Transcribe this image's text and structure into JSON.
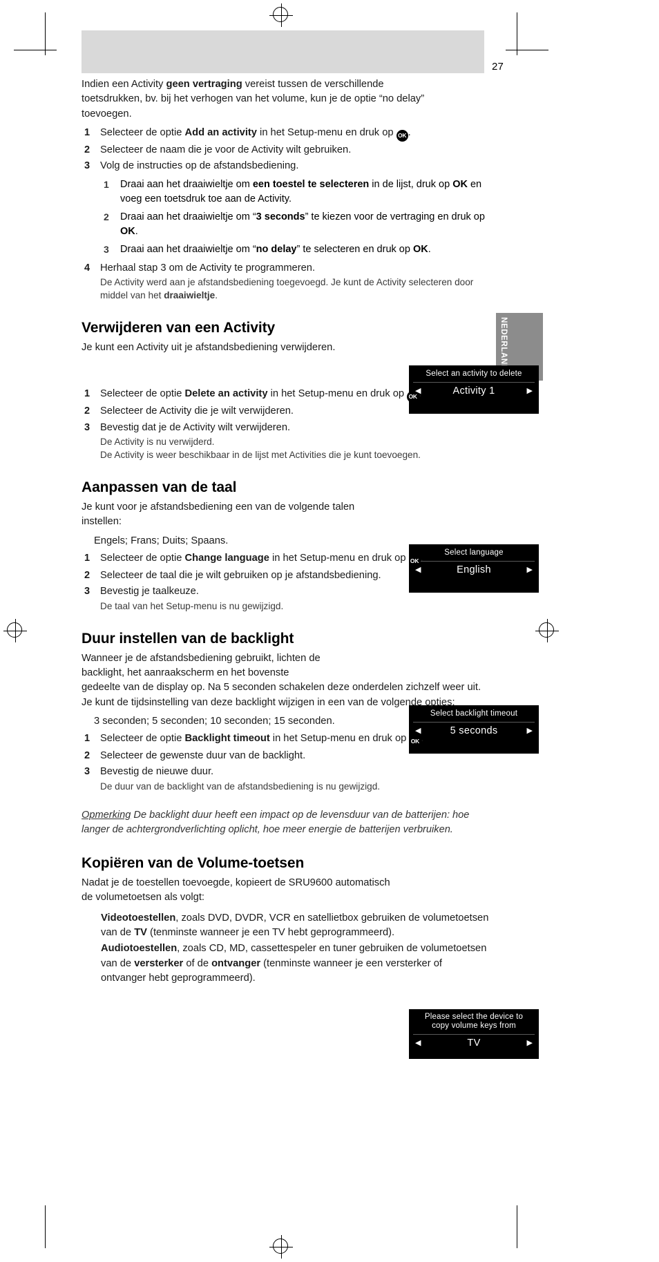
{
  "page": {
    "number": "27",
    "side_tab_label": "NEDERLANDS"
  },
  "intro": {
    "text_before": "Indien een Activity ",
    "bold1": "geen vertraging",
    "text_after": " vereist tussen de verschillende toetsdrukken, bv. bij het verhogen van het volume, kun je de optie “no delay” toevoegen."
  },
  "section_add": {
    "steps": [
      {
        "num": "1",
        "pre": "Selecteer de optie ",
        "bold": "Add an activity",
        "post": " in het Setup-menu en druk op ",
        "tail": "."
      },
      {
        "num": "2",
        "pre": "Selecteer de naam die je voor de Activity wilt gebruiken.",
        "bold": "",
        "post": "",
        "tail": ""
      },
      {
        "num": "3",
        "pre": "Volg de instructies op de afstandsbediening.",
        "bold": "",
        "post": "",
        "tail": ""
      }
    ],
    "substeps": [
      {
        "num": "1",
        "pre": "Draai aan het draaiwieltje om ",
        "bold": "een toestel te selecteren",
        "mid": " in de lijst, druk op ",
        "bold2": "OK",
        "post": " en voeg een toetsdruk toe aan de Activity."
      },
      {
        "num": "2",
        "pre": "Draai aan het draaiwieltje om “",
        "bold": "3 seconds",
        "mid": "” te kiezen voor de vertraging en druk op ",
        "bold2": "OK",
        "post": "."
      },
      {
        "num": "3",
        "pre": "Draai aan het draaiwieltje om “",
        "bold": "no delay",
        "mid": "” te selecteren en druk op ",
        "bold2": "OK",
        "post": "."
      }
    ],
    "step4": {
      "num": "4",
      "text": "Herhaal stap 3 om de Activity te programmeren.",
      "note_pre": "De Activity werd aan je afstandsbediening toegevoegd. Je kunt de Activity selecteren door middel van het ",
      "note_bold": "draaiwieltje",
      "note_post": "."
    }
  },
  "section_delete": {
    "heading": "Verwijderen van een Activity",
    "lead": "Je kunt een Activity uit je afstandsbediening verwijderen.",
    "lcd": {
      "title": "Select an activity to delete",
      "value": "Activity 1",
      "left_arrow": "◀",
      "right_arrow": "▶"
    },
    "steps": [
      {
        "num": "1",
        "pre": "Selecteer de optie ",
        "bold": "Delete an activity",
        "post": " in het Setup-menu en druk op ",
        "tail": "."
      },
      {
        "num": "2",
        "pre": "Selecteer de Activity die je wilt verwijderen.",
        "bold": "",
        "post": "",
        "tail": ""
      },
      {
        "num": "3",
        "pre": "Bevestig dat je de Activity wilt verwijderen.",
        "bold": "",
        "post": "",
        "tail": ""
      }
    ],
    "note1": "De Activity is nu verwijderd.",
    "note2": "De Activity is weer beschikbaar in de lijst met Activities die je kunt toevoegen."
  },
  "section_language": {
    "heading": "Aanpassen van de taal",
    "lead": "Je kunt voor je afstandsbediening een van de volgende talen instellen:",
    "lcd": {
      "title": "Select language",
      "value": "English",
      "left_arrow": "◀",
      "right_arrow": "▶"
    },
    "options": "Engels;        Frans;        Duits;        Spaans.",
    "steps": [
      {
        "num": "1",
        "pre": "Selecteer de optie ",
        "bold": "Change language",
        "post": " in het Setup-menu en druk op ",
        "tail": "."
      },
      {
        "num": "2",
        "pre": "Selecteer de taal die je wilt gebruiken op je afstandsbediening.",
        "bold": "",
        "post": "",
        "tail": ""
      },
      {
        "num": "3",
        "pre": "Bevestig je taalkeuze.",
        "bold": "",
        "post": "",
        "tail": ""
      }
    ],
    "note1": "De taal van het Setup-menu is nu gewijzigd."
  },
  "section_backlight": {
    "heading": "Duur instellen van de backlight",
    "lead1": "Wanneer je de afstandsbediening gebruikt, lichten de backlight, het aanraakscherm en het bovenste",
    "lead2": "gedeelte van de display op. Na 5 seconden schakelen deze onderdelen zichzelf weer uit.",
    "lead3": "Je kunt de tijdsinstelling van deze backlight wijzigen in een van de volgende opties:",
    "lcd": {
      "title": "Select backlight timeout",
      "value": "5 seconds",
      "left_arrow": "◀",
      "right_arrow": "▶"
    },
    "options": "3 seconden;       5 seconden;       10 seconden;       15 seconden.",
    "steps": [
      {
        "num": "1",
        "pre": "Selecteer de optie ",
        "bold": "Backlight timeout",
        "post": " in het Setup-menu en druk op ",
        "tail": "."
      },
      {
        "num": "2",
        "pre": "Selecteer de gewenste duur van de backlight.",
        "bold": "",
        "post": "",
        "tail": ""
      },
      {
        "num": "3",
        "pre": "Bevestig de nieuwe duur.",
        "bold": "",
        "post": "",
        "tail": ""
      }
    ],
    "note1": "De duur van de backlight van de afstandsbediening is nu gewijzigd.",
    "note_label": "Opmerking",
    "note_text": " De backlight duur heeft een impact op de levensduur van de batterijen: hoe langer de achtergrondverlichting oplicht, hoe meer energie de batterijen verbruiken."
  },
  "section_volume": {
    "heading": "Kopiëren van de Volume-toetsen",
    "lead": "Nadat je de toestellen toevoegde, kopieert de SRU9600 automatisch de volumetoetsen als volgt:",
    "lcd": {
      "title_line1": "Please select the device to",
      "title_line2": "copy volume keys from",
      "value": "TV",
      "left_arrow": "◀",
      "right_arrow": "▶"
    },
    "video": {
      "bold": "Videotoestellen",
      "mid": ", zoals DVD, DVDR, VCR en satellietbox gebruiken de volumetoetsen van de ",
      "bold2": "TV",
      "post": " (tenminste wanneer je een TV hebt geprogrammeerd)."
    },
    "audio": {
      "bold": "Audiotoestellen",
      "mid": ", zoals CD, MD, cassettespeler en tuner gebruiken de volumetoetsen van de ",
      "bold2": "versterker",
      "mid2": " of de ",
      "bold3": "ontvanger",
      "post": " (tenminste wanneer je een versterker of ontvanger hebt geprogrammeerd)."
    }
  },
  "icons": {
    "ok_badge": "OK"
  }
}
